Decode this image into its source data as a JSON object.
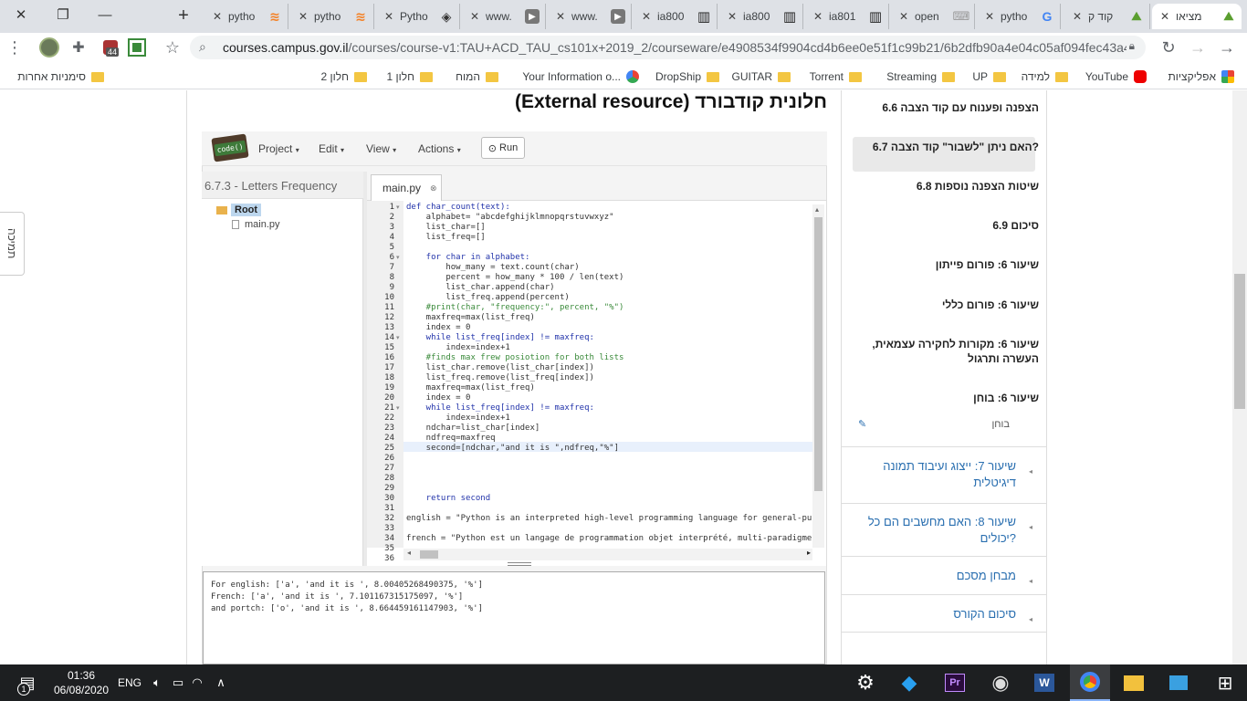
{
  "window_controls": {
    "close": "✕",
    "restore": "❐",
    "minimize": "—",
    "new_tab": "+"
  },
  "tabs": [
    {
      "title": "pytho",
      "icon": "stackoverflow-icon"
    },
    {
      "title": "pytho",
      "icon": "stackoverflow-icon"
    },
    {
      "title": "Pytho",
      "icon": "python-icon"
    },
    {
      "title": "www.",
      "icon": "video-icon"
    },
    {
      "title": "www.",
      "icon": "video-icon"
    },
    {
      "title": "ia800",
      "icon": "archive-icon"
    },
    {
      "title": "ia800",
      "icon": "archive-icon"
    },
    {
      "title": "ia801",
      "icon": "archive-icon"
    },
    {
      "title": "open",
      "icon": "keyboard-icon"
    },
    {
      "title": "pytho",
      "icon": "google-icon"
    },
    {
      "title": "קוד ק",
      "icon": "edx-icon"
    },
    {
      "title": "מציאו",
      "icon": "edx-icon",
      "active": true
    }
  ],
  "toolbar": {
    "url_host": "courses.campus.gov.il",
    "url_path": "/courses/course-v1:TAU+ACD_TAU_cs101x+2019_2/courseware/e4908534f9904cd4b6ee0e51f1c99b21/6b2dfb90a4e04c05af094fec43a4...",
    "badge": "44"
  },
  "bookmarks": [
    {
      "label": "אפליקציות",
      "icon": "apps"
    },
    {
      "label": "YouTube",
      "icon": "youtube"
    },
    {
      "label": "למידה",
      "icon": "folder"
    },
    {
      "label": "UP",
      "icon": "folder"
    },
    {
      "label": "Streaming",
      "icon": "folder"
    },
    {
      "label": "Torrent",
      "icon": "folder"
    },
    {
      "label": "GUITAR",
      "icon": "folder"
    },
    {
      "label": "DropShip",
      "icon": "folder"
    },
    {
      "label": "Your Information o...",
      "icon": "site"
    },
    {
      "label": "המוח",
      "icon": "folder"
    },
    {
      "label": "חלון 1",
      "icon": "folder"
    },
    {
      "label": "חלון 2",
      "icon": "folder"
    },
    {
      "label": "סימניות אחרות",
      "icon": "folder"
    }
  ],
  "page": {
    "heading": "חלונית קודבורד (External resource)",
    "side_tab": "תמיכה"
  },
  "ide": {
    "logo": "code()",
    "menus": [
      "Project",
      "Edit",
      "View",
      "Actions"
    ],
    "run_label": "Run",
    "project_title": "6.7.3 - Letters Frequency",
    "root_label": "Root",
    "file_label": "main.py",
    "tab_label": "main.py",
    "line_numbers": [
      "1",
      "2",
      "3",
      "4",
      "5",
      "6",
      "7",
      "8",
      "9",
      "10",
      "11",
      "12",
      "13",
      "14",
      "15",
      "16",
      "17",
      "18",
      "19",
      "20",
      "21",
      "22",
      "23",
      "24",
      "25",
      "26",
      "27",
      "28",
      "29",
      "30",
      "31",
      "32",
      "33",
      "34",
      "35",
      "36"
    ],
    "fold_lines": [
      "1",
      "6",
      "14",
      "21"
    ],
    "code_lines": [
      "def char_count(text):",
      "    alphabet= \"abcdefghijklmnopqrstuvwxyz\"",
      "    list_char=[]",
      "    list_freq=[]",
      "",
      "    for char in alphabet:",
      "        how_many = text.count(char)",
      "        percent = how_many * 100 / len(text)",
      "        list_char.append(char)",
      "        list_freq.append(percent)",
      "    #print(char, \"frequency:\", percent, \"%\")",
      "    maxfreq=max(list_freq)",
      "    index = 0",
      "    while list_freq[index] != maxfreq:",
      "        index=index+1",
      "    #finds max frew posiotion for both lists",
      "    list_char.remove(list_char[index])",
      "    list_freq.remove(list_freq[index])",
      "    maxfreq=max(list_freq)",
      "    index = 0",
      "    while list_freq[index] != maxfreq:",
      "        index=index+1",
      "    ndchar=list_char[index]",
      "    ndfreq=maxfreq",
      "    second=[ndchar,\"and it is \",ndfreq,\"%\"]",
      "",
      "",
      "",
      "",
      "    return second",
      "",
      "english = \"Python is an interpreted high-level programming language for general-purp",
      "",
      "french = \"Python est un langage de programmation objet interprété, multi-paradigme e",
      "",
      ""
    ],
    "output_lines": [
      "For english: ['a', 'and it is ', 8.00405268490375, '%']",
      "French: ['a', 'and it is ', 7.101167315175097, '%']",
      "and portch: ['o', 'and it is ', 8.664459161147903, '%']"
    ]
  },
  "nav": {
    "items": [
      "6.6 הצפנה ופענוח עם קוד הצבה",
      "6.7 האם ניתן \"לשבור\" קוד הצבה?",
      "6.8 שיטות הצפנה נוספות",
      "6.9 סיכום",
      "שיעור 6: פורום פייתון",
      "שיעור 6: פורום כללי",
      "שיעור 6: מקורות לחקירה עצמאית, העשרה ותרגול",
      "שיעור 6: בוחן"
    ],
    "exam_sub": "בוחן",
    "sections": [
      "שיעור 7: ייצוג ועיבוד תמונה דיגיטלית",
      "שיעור 8: האם מחשבים הם כל יכולים?",
      "מבחן מסכם",
      "סיכום הקורס"
    ]
  },
  "taskbar": {
    "time": "01:36",
    "date": "06/08/2020",
    "lang": "ENG",
    "notif_count": "1"
  }
}
